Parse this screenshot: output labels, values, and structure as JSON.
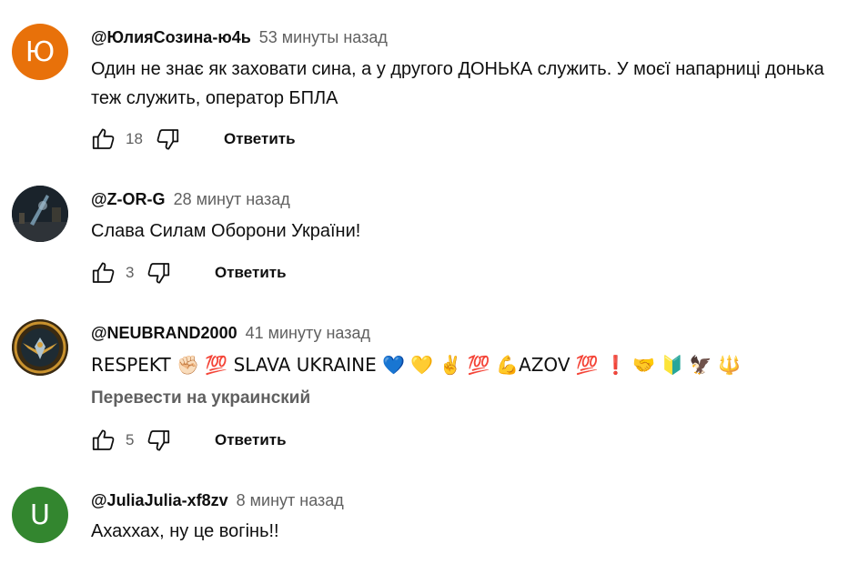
{
  "reply_label": "Ответить",
  "icons": {
    "like": "thumb-up-icon",
    "dislike": "thumb-down-icon"
  },
  "comments": [
    {
      "avatar_letter": "Ю",
      "avatar_color": "#e8710a",
      "author": "@ЮлияСозина-ю4ь",
      "time": "53 минуты назад",
      "text": "Один не знає як заховати сина, а у другого ДОНЬКА служить. У моєї напарниці донька теж служить, оператор БПЛА",
      "likes": "18"
    },
    {
      "avatar_letter": "",
      "avatar_color": "#1d2a33",
      "author": "@Z-OR-G",
      "time": "28 минут назад",
      "text": "Слава Силам Оборони України!",
      "likes": "3"
    },
    {
      "avatar_letter": "",
      "avatar_color": "#2b2214",
      "author": "@NEUBRAND2000",
      "time": "41 минуту назад",
      "text": "RESPEKT ✊🏻 💯 SLAVA UKRAINE 💙 💛 ✌️ 💯 💪AZOV 💯 ❗ 🤝 🔰 🦅 🔱",
      "translate": "Перевести на украинский",
      "likes": "5"
    },
    {
      "avatar_letter": "U",
      "avatar_color": "#33862f",
      "author": "@JuliaJulia-xf8zv",
      "time": "8 минут назад",
      "text": "Ахаххах, ну це вогінь!!"
    }
  ]
}
